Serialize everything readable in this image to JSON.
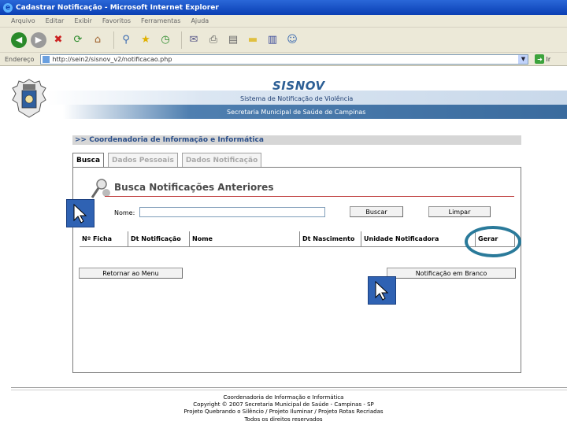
{
  "window": {
    "title": "Cadastrar Notificação - Microsoft Internet Explorer"
  },
  "menu": {
    "items": [
      "Arquivo",
      "Editar",
      "Exibir",
      "Favoritos",
      "Ferramentas",
      "Ajuda"
    ]
  },
  "address": {
    "label": "Endereço",
    "url": "http://sein2/sisnov_v2/notificacao.php",
    "go_label": "Ir"
  },
  "header": {
    "app_name": "SISNOV",
    "subtitle": "Sistema de Notificação de Violência",
    "secretaria": "Secretaria Municipal de Saúde de Campinas"
  },
  "coordenadoria_bar": ">> Coordenadoria de Informação e Informática",
  "tabs": [
    {
      "label": "Busca",
      "active": true
    },
    {
      "label": "Dados Pessoais",
      "active": false
    },
    {
      "label": "Dados Notificação",
      "active": false
    }
  ],
  "search": {
    "title": "Busca Notificações Anteriores",
    "nome_label": "Nome:",
    "nome_value": "",
    "buscar_label": "Buscar",
    "limpar_label": "Limpar"
  },
  "table": {
    "headers": [
      "Nº Ficha",
      "Dt Notificação",
      "Nome",
      "Dt Nascimento",
      "Unidade Notificadora",
      "Gerar"
    ]
  },
  "actions": {
    "retornar_label": "Retornar ao Menu",
    "branco_label": "Notificação em Branco"
  },
  "footer": {
    "lines": [
      "Coordenadoria de Informação e Informática",
      "Copyright © 2007 Secretaria Municipal de Saúde - Campinas - SP",
      "Projeto Quebrando o Silêncio / Projeto Iluminar / Projeto Rotas Recriadas",
      "Todos os direitos reservados"
    ]
  },
  "colors": {
    "titlebar": "#0a3fb3",
    "brand": "#2d5f95",
    "gerar_highlight": "#2a7a9a"
  }
}
